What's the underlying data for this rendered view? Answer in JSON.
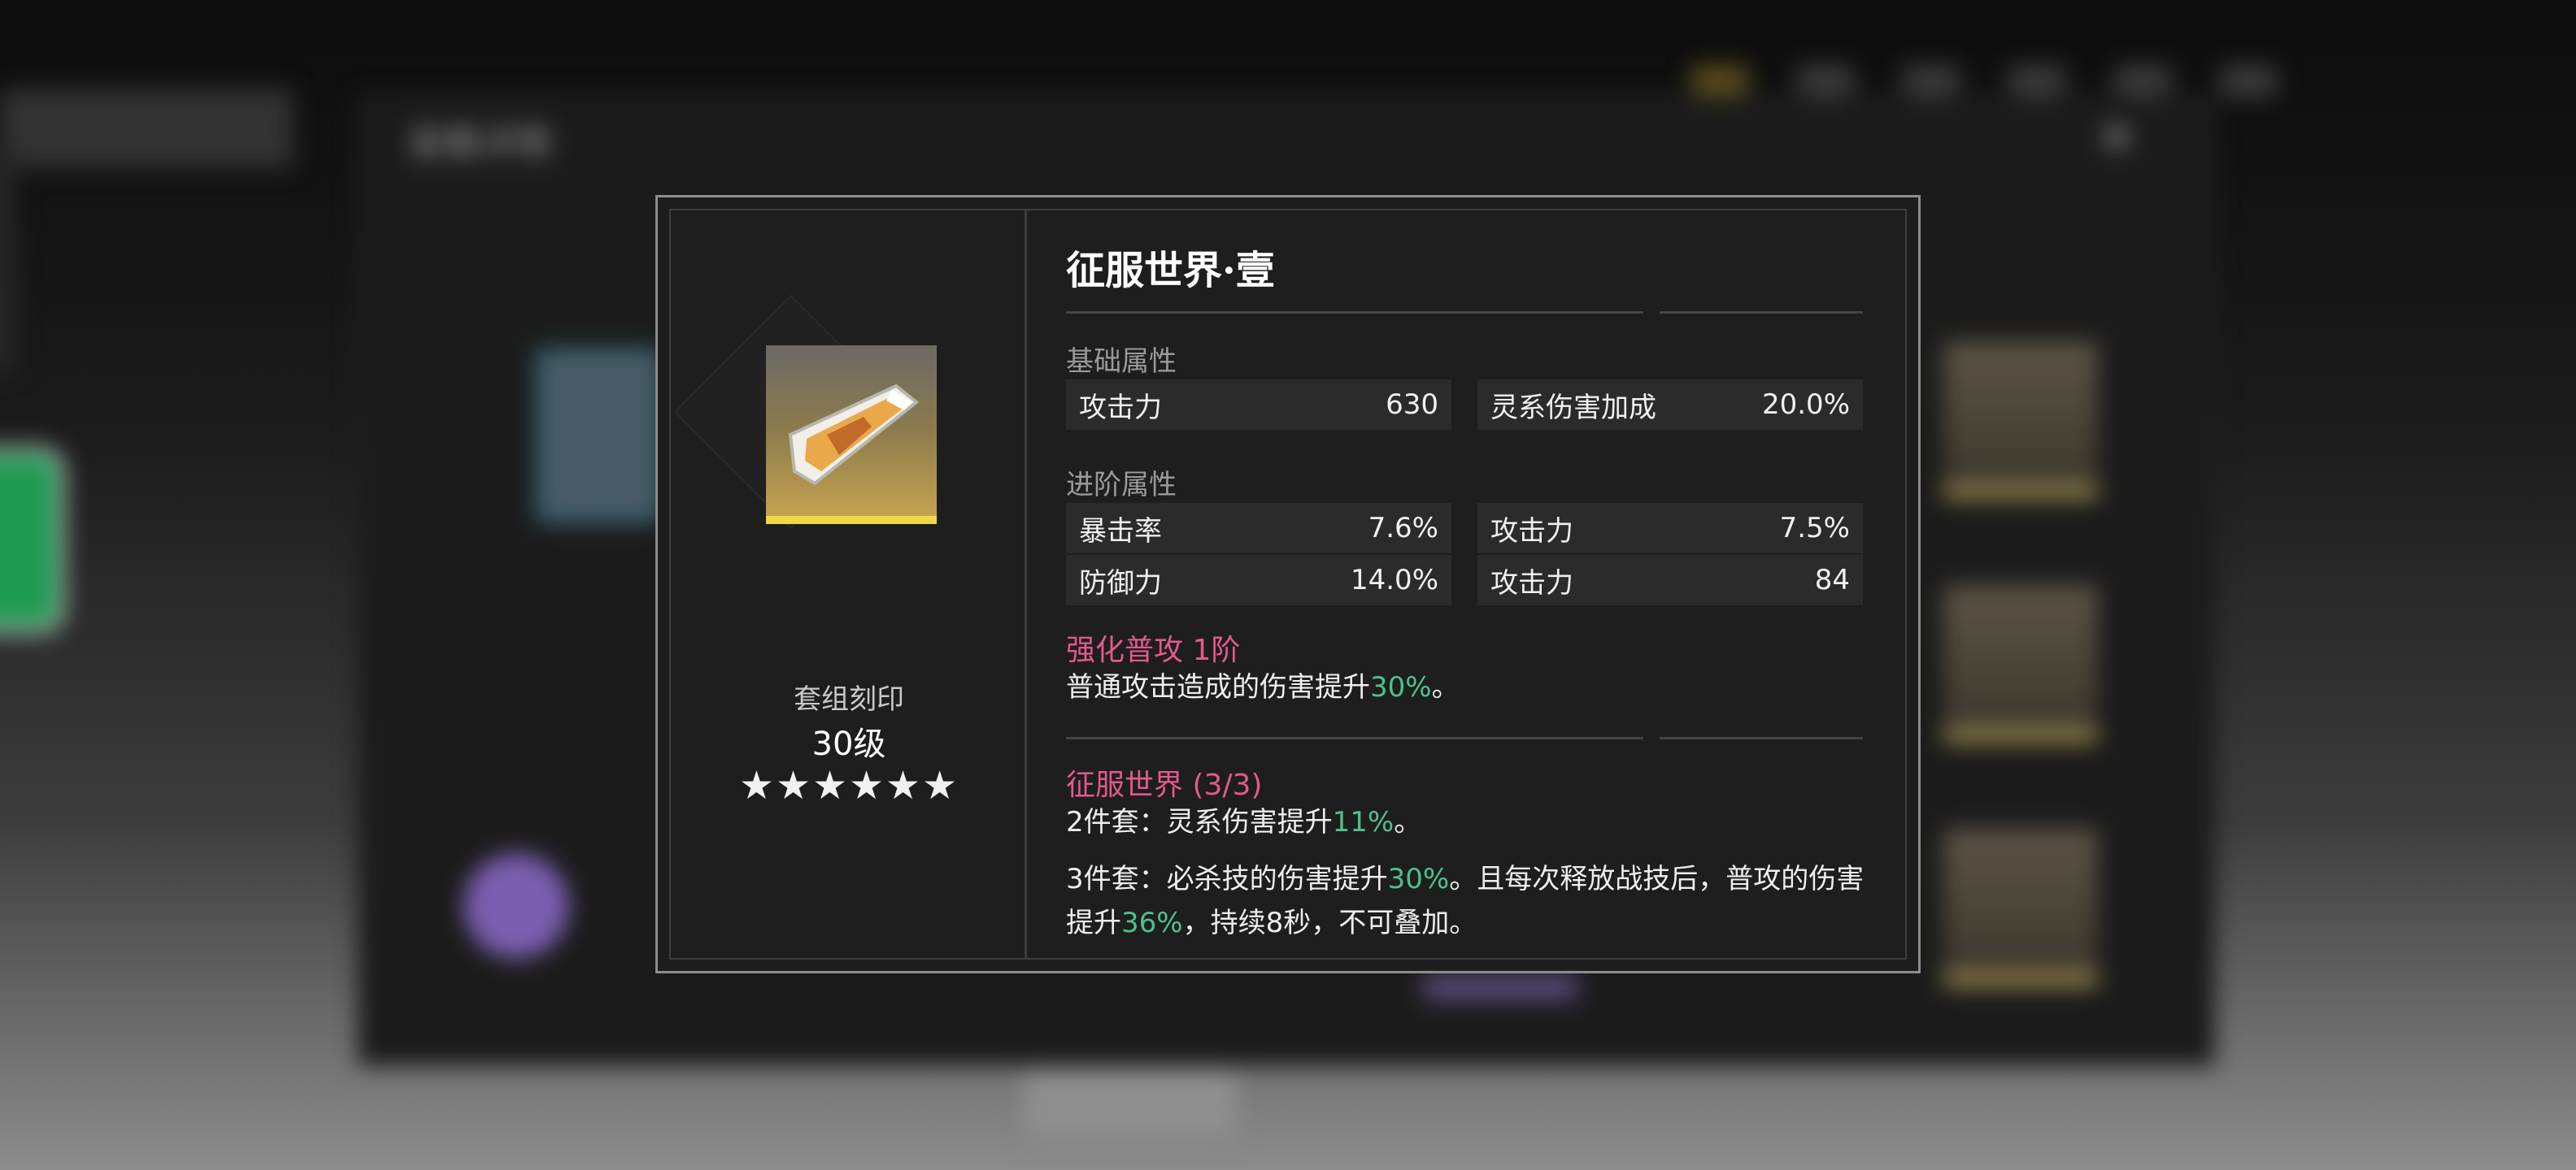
{
  "background": {
    "panel_title": "查看详情",
    "close_glyph": "✕"
  },
  "item": {
    "icon": "crystal-shard-icon",
    "set_name": "套组刻印",
    "level": "30级",
    "stars": "★★★★★★",
    "star_count": 6,
    "title": "征服世界·壹"
  },
  "base_stats": {
    "label": "基础属性",
    "rows": [
      {
        "name": "攻击力",
        "value": "630"
      },
      {
        "name": "灵系伤害加成",
        "value": "20.0%"
      }
    ]
  },
  "advanced_stats": {
    "label": "进阶属性",
    "rows": [
      {
        "name": "暴击率",
        "value": "7.6%"
      },
      {
        "name": "攻击力",
        "value": "7.5%"
      },
      {
        "name": "防御力",
        "value": "14.0%"
      },
      {
        "name": "攻击力",
        "value": "84"
      }
    ]
  },
  "enhance": {
    "title": "强化普攻 1阶",
    "desc_prefix": "普通攻击造成的伤害提升",
    "desc_value": "30%",
    "desc_suffix": "。"
  },
  "set_bonus": {
    "title": "征服世界 (3/3)",
    "two_piece_prefix": "2件套：灵系伤害提升",
    "two_piece_value": "11%",
    "two_piece_suffix": "。",
    "three_piece_prefix": "3件套：必杀技的伤害提升",
    "three_piece_value1": "30%",
    "three_piece_mid": "。且每次释放战技后，普攻的伤害提升",
    "three_piece_value2": "36%",
    "three_piece_suffix": "，持续8秒，不可叠加。"
  },
  "colors": {
    "pink": "#e05a8c",
    "green": "#4fc08d",
    "gold": "#f2d64a"
  }
}
